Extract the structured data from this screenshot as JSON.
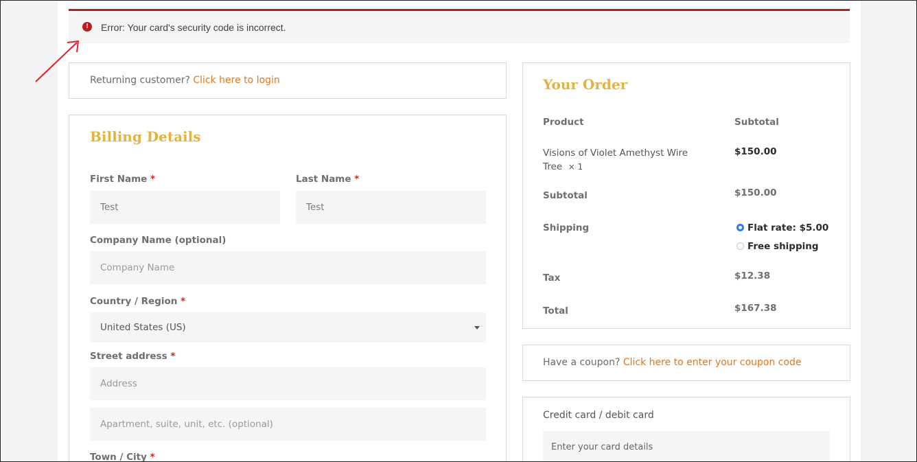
{
  "notice": {
    "message": "Error: Your card's security code is incorrect.",
    "icon": "error-circle-icon",
    "color": "#b81c23"
  },
  "login": {
    "prompt": "Returning customer?",
    "link": "Click here to login"
  },
  "billing": {
    "title": "Billing Details",
    "first_name": {
      "label": "First Name",
      "required": "*",
      "value": "Test"
    },
    "last_name": {
      "label": "Last Name",
      "required": "*",
      "value": "Test"
    },
    "company": {
      "label": "Company Name (optional)",
      "placeholder": "Company Name"
    },
    "country": {
      "label": "Country / Region",
      "required": "*",
      "value": "United States (US)"
    },
    "street": {
      "label": "Street address",
      "required": "*",
      "placeholder1": "Address",
      "placeholder2": "Apartment, suite, unit, etc. (optional)"
    },
    "city": {
      "label": "Town / City",
      "required": "*"
    }
  },
  "order": {
    "title": "Your Order",
    "col_product": "Product",
    "col_subtotal": "Subtotal",
    "item_name_line1": "Visions of Violet Amethyst Wire",
    "item_name_line2": "Tree",
    "item_qty": "× 1",
    "item_price": "$150.00",
    "subtotal_label": "Subtotal",
    "subtotal_value": "$150.00",
    "shipping_label": "Shipping",
    "shipping_options": [
      {
        "label": "Flat rate: $5.00",
        "selected": true
      },
      {
        "label": "Free shipping",
        "selected": false
      }
    ],
    "tax_label": "Tax",
    "tax_value": "$12.38",
    "total_label": "Total",
    "total_value": "$167.38"
  },
  "coupon": {
    "prompt": "Have a coupon?",
    "link": "Click here to enter your coupon code"
  },
  "payment": {
    "method": "Credit card / debit card",
    "card_placeholder": "Enter your card details"
  },
  "colors": {
    "accent": "#e3b33f",
    "link": "#e8751a",
    "required": "#d62020",
    "annotation_arrow": "#e0202a"
  }
}
